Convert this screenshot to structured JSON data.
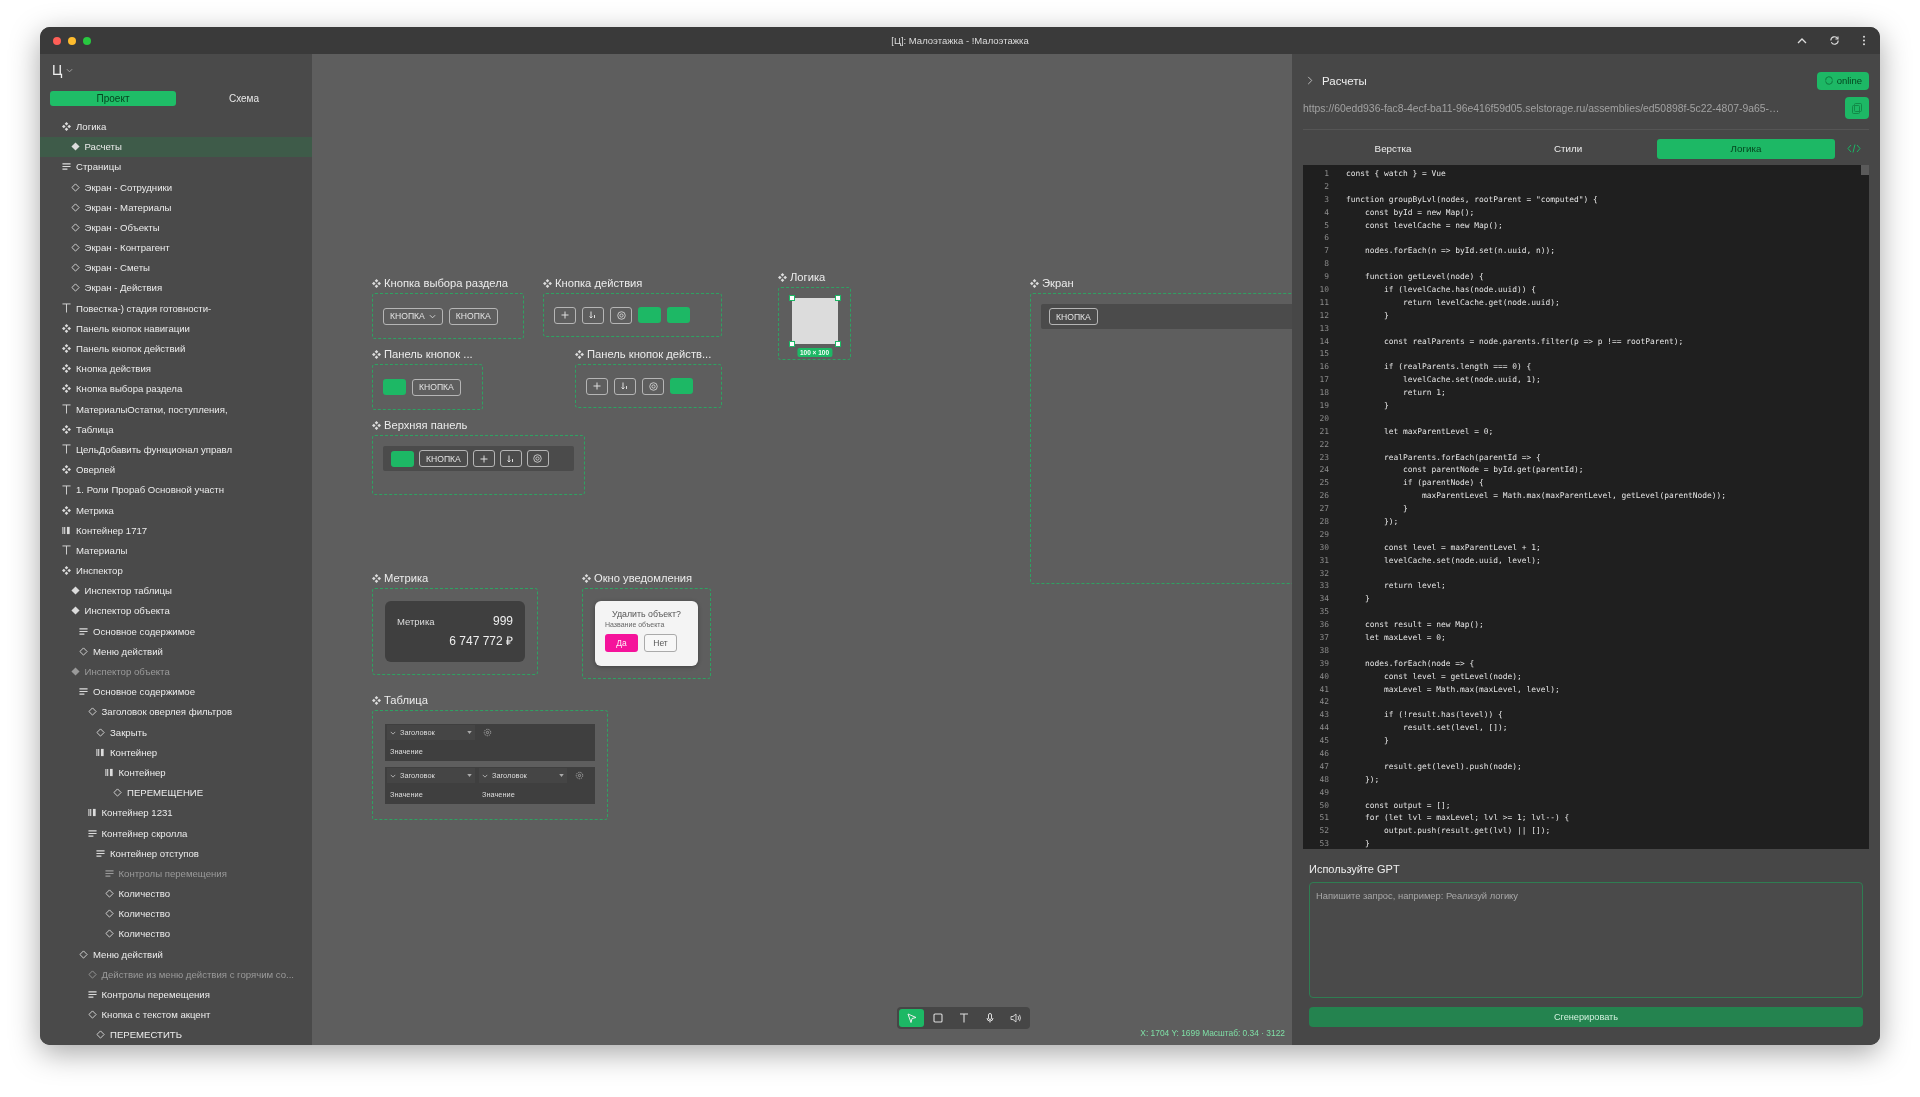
{
  "window": {
    "title": "[Ц]: Малоэтажка - !Малоэтажка"
  },
  "sidebar": {
    "project": "Ц",
    "tabs": [
      {
        "label": "Проект",
        "selected": true
      },
      {
        "label": "Схема",
        "selected": false
      }
    ],
    "tree": [
      {
        "label": "Логика",
        "kind": "component",
        "selected": false,
        "dimmed": false,
        "children": [
          {
            "label": "Расчеты",
            "kind": "instance",
            "selected": true,
            "dimmed": false
          }
        ]
      },
      {
        "label": "Страницы",
        "kind": "stack",
        "selected": false,
        "dimmed": false,
        "children": [
          {
            "label": "Экран - Сотрудники",
            "kind": "variant",
            "selected": false,
            "dimmed": false
          },
          {
            "label": "Экран - Материалы",
            "kind": "variant",
            "selected": false,
            "dimmed": false
          },
          {
            "label": "Экран - Объекты",
            "kind": "variant",
            "selected": false,
            "dimmed": false
          },
          {
            "label": "Экран - Контрагент",
            "kind": "variant",
            "selected": false,
            "dimmed": false
          },
          {
            "label": "Экран - Сметы",
            "kind": "variant",
            "selected": false,
            "dimmed": false
          },
          {
            "label": "Экран - Действия",
            "kind": "variant",
            "selected": false,
            "dimmed": false
          }
        ]
      },
      {
        "label": "Повестка-) стадия готовности-",
        "kind": "text",
        "selected": false,
        "dimmed": false
      },
      {
        "label": "Панель кнопок навигации",
        "kind": "component",
        "selected": false,
        "dimmed": false
      },
      {
        "label": "Панель кнопок действий",
        "kind": "component",
        "selected": false,
        "dimmed": false
      },
      {
        "label": "Кнопка действия",
        "kind": "component",
        "selected": false,
        "dimmed": false
      },
      {
        "label": "Кнопка выбора раздела",
        "kind": "component",
        "selected": false,
        "dimmed": false
      },
      {
        "label": "МатериалыОстатки, поступления,",
        "kind": "text",
        "selected": false,
        "dimmed": false
      },
      {
        "label": "Таблица",
        "kind": "component",
        "selected": false,
        "dimmed": false
      },
      {
        "label": "ЦельДобавить функционал управл",
        "kind": "text",
        "selected": false,
        "dimmed": false
      },
      {
        "label": "Оверлей",
        "kind": "component",
        "selected": false,
        "dimmed": false
      },
      {
        "label": "1. Роли Прораб Основной участн",
        "kind": "text",
        "selected": false,
        "dimmed": false
      },
      {
        "label": "Метрика",
        "kind": "component",
        "selected": false,
        "dimmed": false
      },
      {
        "label": "Контейнер 1717",
        "kind": "container",
        "selected": false,
        "dimmed": false
      },
      {
        "label": "Материалы",
        "kind": "text",
        "selected": false,
        "dimmed": false
      },
      {
        "label": "Инспектор",
        "kind": "component",
        "selected": false,
        "dimmed": false,
        "children": [
          {
            "label": "Инспектор таблицы",
            "kind": "instance",
            "selected": false,
            "dimmed": false
          },
          {
            "label": "Инспектор объекта",
            "kind": "instance",
            "selected": false,
            "dimmed": false,
            "children": [
              {
                "label": "Основное содержимое",
                "kind": "stack",
                "selected": false,
                "dimmed": false
              },
              {
                "label": "Меню действий",
                "kind": "variant",
                "selected": false,
                "dimmed": false
              }
            ]
          },
          {
            "label": "Инспектор объекта",
            "kind": "instance",
            "selected": false,
            "dimmed": true,
            "children": [
              {
                "label": "Основное содержимое",
                "kind": "stack",
                "selected": false,
                "dimmed": false,
                "children": [
                  {
                    "label": "Заголовок оверлея фильтров",
                    "kind": "variant",
                    "selected": false,
                    "dimmed": false,
                    "children": [
                      {
                        "label": "Закрыть",
                        "kind": "variant",
                        "selected": false,
                        "dimmed": false
                      },
                      {
                        "label": "Контейнер",
                        "kind": "container",
                        "selected": false,
                        "dimmed": false,
                        "children": [
                          {
                            "label": "Контейнер",
                            "kind": "container",
                            "selected": false,
                            "dimmed": false,
                            "children": [
                              {
                                "label": "ПЕРЕМЕЩЕНИЕ",
                                "kind": "variant",
                                "selected": false,
                                "dimmed": false
                              }
                            ]
                          }
                        ]
                      }
                    ]
                  },
                  {
                    "label": "Контейнер 1231",
                    "kind": "container",
                    "selected": false,
                    "dimmed": false
                  },
                  {
                    "label": "Контейнер скролла",
                    "kind": "stack",
                    "selected": false,
                    "dimmed": false,
                    "children": [
                      {
                        "label": "Контейнер отступов",
                        "kind": "stack",
                        "selected": false,
                        "dimmed": false,
                        "children": [
                          {
                            "label": "Контролы перемещения",
                            "kind": "stack",
                            "selected": false,
                            "dimmed": true
                          },
                          {
                            "label": "Количество",
                            "kind": "variant",
                            "selected": false,
                            "dimmed": false
                          },
                          {
                            "label": "Количество",
                            "kind": "variant",
                            "selected": false,
                            "dimmed": false
                          },
                          {
                            "label": "Количество",
                            "kind": "variant",
                            "selected": false,
                            "dimmed": false
                          }
                        ]
                      }
                    ]
                  }
                ]
              },
              {
                "label": "Меню действий",
                "kind": "variant",
                "selected": false,
                "dimmed": false,
                "children": [
                  {
                    "label": "Действие из меню действия с горячим со...",
                    "kind": "variant",
                    "selected": false,
                    "dimmed": true
                  },
                  {
                    "label": "Контролы перемещения",
                    "kind": "stack",
                    "selected": false,
                    "dimmed": false
                  },
                  {
                    "label": "Кнопка с текстом акцент",
                    "kind": "variant",
                    "selected": false,
                    "dimmed": false,
                    "children": [
                      {
                        "label": "ПЕРЕМЕСТИТЬ",
                        "kind": "variant",
                        "selected": false,
                        "dimmed": false
                      }
                    ]
                  }
                ]
              }
            ]
          }
        ]
      }
    ]
  },
  "canvas": {
    "frames": [
      {
        "kind": "row",
        "title": "Кнопка выбора раздела",
        "items": [
          {
            "kind": "dropdown",
            "label": "КНОПКА"
          },
          {
            "kind": "outline",
            "label": "КНОПКА"
          }
        ]
      },
      {
        "kind": "row",
        "title": "Кнопка действия",
        "items": [
          {
            "kind": "plus"
          },
          {
            "kind": "sort"
          },
          {
            "kind": "at"
          },
          {
            "kind": "accent"
          },
          {
            "kind": "accent"
          }
        ]
      },
      {
        "kind": "logic",
        "title": "Логика",
        "size": "100 × 100"
      },
      {
        "kind": "bar",
        "title": "Экран",
        "items": [
          {
            "kind": "outline",
            "label": "КНОПКА"
          }
        ]
      },
      {
        "kind": "row",
        "title": "Панель кнопок ...",
        "items": [
          {
            "kind": "accent"
          },
          {
            "kind": "outline",
            "label": "КНОПКА"
          }
        ]
      },
      {
        "kind": "row",
        "title": "Панель кнопок действ...",
        "items": [
          {
            "kind": "plus"
          },
          {
            "kind": "sort"
          },
          {
            "kind": "at"
          },
          {
            "kind": "accent"
          }
        ]
      },
      {
        "kind": "bar",
        "title": "Верхняя панель",
        "items": [
          {
            "kind": "accent"
          },
          {
            "kind": "outline",
            "label": "КНОПКА"
          },
          {
            "kind": "plus"
          },
          {
            "kind": "sort"
          },
          {
            "kind": "at"
          }
        ]
      },
      {
        "kind": "metric",
        "title": "Метрика",
        "label": "Метрика",
        "count": "999",
        "value": "6 747 772 ₽"
      },
      {
        "kind": "dialog",
        "title": "Окно уведомления",
        "question": "Удалить объект?",
        "subtitle": "Название объекта",
        "buttons": [
          {
            "kind": "danger",
            "label": "Да"
          },
          {
            "kind": "outline",
            "label": "Нет"
          }
        ]
      },
      {
        "kind": "table",
        "title": "Таблица",
        "groups": [
          {
            "columns": [
              {
                "header": "Заголовок",
                "value": "Значение"
              }
            ]
          },
          {
            "columns": [
              {
                "header": "Заголовок",
                "value": "Значение"
              },
              {
                "header": "Заголовок",
                "value": "Значение"
              }
            ]
          }
        ]
      }
    ],
    "tools": [
      {
        "kind": "pointer",
        "selected": true
      },
      {
        "kind": "rect",
        "selected": false
      },
      {
        "kind": "text",
        "selected": false
      },
      {
        "kind": "mic",
        "selected": false
      },
      {
        "kind": "speaker",
        "selected": false
      }
    ],
    "status": "X: 1704 Y: 1699 Масштаб: 0.34 · 3122"
  },
  "panel": {
    "title": "Расчеты",
    "status": "online",
    "url": "https://60edd936-fac8-4ecf-ba11-96e416f59d05.selstorage.ru/assemblies/ed50898f-5c22-4807-9a65-…",
    "tabs": [
      {
        "label": "Верстка",
        "selected": false
      },
      {
        "label": "Стили",
        "selected": false
      },
      {
        "label": "Логика",
        "selected": true
      }
    ],
    "code": [
      {
        "n": "1",
        "text": "const { watch } = Vue"
      },
      {
        "n": "2"
      },
      {
        "n": "3",
        "text": "function groupByLvl(nodes, rootParent = \"computed\") {"
      },
      {
        "n": "4",
        "text": "    const byId = new Map();"
      },
      {
        "n": "5",
        "text": "    const levelCache = new Map();"
      },
      {
        "n": "6"
      },
      {
        "n": "7",
        "text": "    nodes.forEach(n => byId.set(n.uuid, n));"
      },
      {
        "n": "8"
      },
      {
        "n": "9",
        "text": "    function getLevel(node) {"
      },
      {
        "n": "10",
        "text": "        if (levelCache.has(node.uuid)) {"
      },
      {
        "n": "11",
        "text": "            return levelCache.get(node.uuid);"
      },
      {
        "n": "12",
        "text": "        }"
      },
      {
        "n": "13"
      },
      {
        "n": "14",
        "text": "        const realParents = node.parents.filter(p => p !== rootParent);"
      },
      {
        "n": "15"
      },
      {
        "n": "16",
        "text": "        if (realParents.length === 0) {"
      },
      {
        "n": "17",
        "text": "            levelCache.set(node.uuid, 1);"
      },
      {
        "n": "18",
        "text": "            return 1;"
      },
      {
        "n": "19",
        "text": "        }"
      },
      {
        "n": "20"
      },
      {
        "n": "21",
        "text": "        let maxParentLevel = 0;"
      },
      {
        "n": "22"
      },
      {
        "n": "23",
        "text": "        realParents.forEach(parentId => {"
      },
      {
        "n": "24",
        "text": "            const parentNode = byId.get(parentId);"
      },
      {
        "n": "25",
        "text": "            if (parentNode) {"
      },
      {
        "n": "26",
        "text": "                maxParentLevel = Math.max(maxParentLevel, getLevel(parentNode));"
      },
      {
        "n": "27",
        "text": "            }"
      },
      {
        "n": "28",
        "text": "        });"
      },
      {
        "n": "29"
      },
      {
        "n": "30",
        "text": "        const level = maxParentLevel + 1;"
      },
      {
        "n": "31",
        "text": "        levelCache.set(node.uuid, level);"
      },
      {
        "n": "32"
      },
      {
        "n": "33",
        "text": "        return level;"
      },
      {
        "n": "34",
        "text": "    }"
      },
      {
        "n": "35"
      },
      {
        "n": "36",
        "text": "    const result = new Map();"
      },
      {
        "n": "37",
        "text": "    let maxLevel = 0;"
      },
      {
        "n": "38"
      },
      {
        "n": "39",
        "text": "    nodes.forEach(node => {"
      },
      {
        "n": "40",
        "text": "        const level = getLevel(node);"
      },
      {
        "n": "41",
        "text": "        maxLevel = Math.max(maxLevel, level);"
      },
      {
        "n": "42"
      },
      {
        "n": "43",
        "text": "        if (!result.has(level)) {"
      },
      {
        "n": "44",
        "text": "            result.set(level, []);"
      },
      {
        "n": "45",
        "text": "        }"
      },
      {
        "n": "46"
      },
      {
        "n": "47",
        "text": "        result.get(level).push(node);"
      },
      {
        "n": "48",
        "text": "    });"
      },
      {
        "n": "49"
      },
      {
        "n": "50",
        "text": "    const output = [];"
      },
      {
        "n": "51",
        "text": "    for (let lvl = maxLevel; lvl >= 1; lvl--) {"
      },
      {
        "n": "52",
        "text": "        output.push(result.get(lvl) || []);"
      },
      {
        "n": "53",
        "text": "    }"
      }
    ],
    "gpt": {
      "label": "Используйте GPT",
      "placeholder": "Напишите запрос, например: Реализуй логику",
      "button": "Сгенерировать"
    }
  }
}
